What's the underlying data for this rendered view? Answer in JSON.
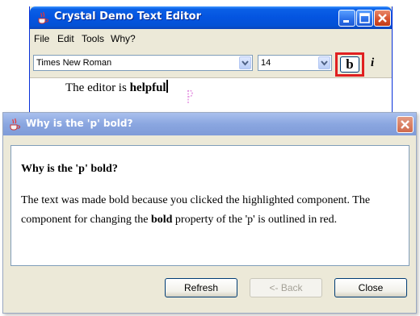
{
  "editor": {
    "title": "Crystal Demo Text Editor",
    "menu": [
      "File",
      "Edit",
      "Tools",
      "Why?"
    ],
    "font_name": "Times New Roman",
    "font_size": "14",
    "bold_label": "b",
    "italic_label": "i",
    "text_plain": "The editor is ",
    "text_bold": "helpful"
  },
  "dialog": {
    "title": "Why is the 'p' bold?",
    "heading": "Why is the 'p' bold?",
    "body_part1": "The text was made bold because you clicked the highlighted component. The component for changing the ",
    "body_bold": "bold",
    "body_part2": " property of the 'p' is outlined in red.",
    "buttons": {
      "refresh": "Refresh",
      "back": "<- Back",
      "close": "Close"
    }
  },
  "colors": {
    "highlight_outline": "#e02020",
    "dialog_background": "#ece9d8"
  }
}
